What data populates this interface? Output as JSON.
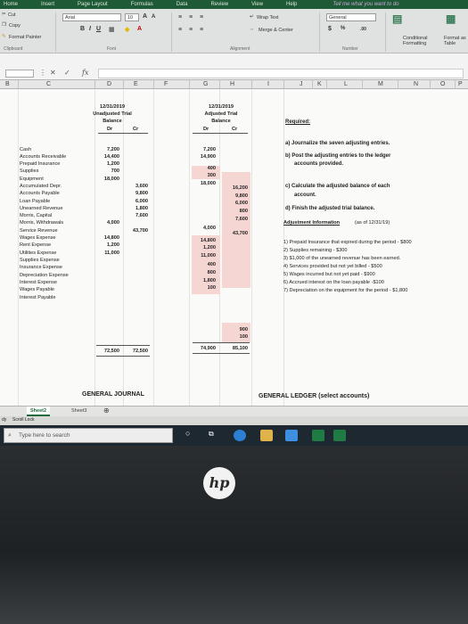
{
  "ribbon_tabs": [
    "Home",
    "Insert",
    "Page Layout",
    "Formulas",
    "Data",
    "Review",
    "View",
    "Help",
    "Tell me what you want to do"
  ],
  "clipboard": {
    "cut": "Cut",
    "copy": "Copy",
    "format_painter": "Format Painter",
    "group": "Clipboard"
  },
  "font": {
    "name": "Arial",
    "size": "10",
    "group": "Font"
  },
  "alignment": {
    "wrap_text": "Wrap Text",
    "merge_center": "Merge & Center",
    "group": "Alignment"
  },
  "number": {
    "format": "General",
    "group": "Number"
  },
  "styles": {
    "conditional": "Conditional Formatting",
    "format_as": "Format as Table"
  },
  "formula_bar": {
    "fx": "fx"
  },
  "columns": [
    "B",
    "C",
    "D",
    "E",
    "F",
    "G",
    "H",
    "I",
    "J",
    "K",
    "L",
    "M",
    "N",
    "O",
    "P"
  ],
  "unadjusted": {
    "date": "12/31/2019",
    "title1": "Unadjusted Trial",
    "title2": "Balance",
    "dr": "Dr",
    "cr": "Cr",
    "dr_values": [
      "7,200",
      "14,400",
      "1,200",
      "700",
      "18,000",
      "4,000",
      "14,800",
      "1,200",
      "11,000"
    ],
    "cr_values": [
      "3,600",
      "9,800",
      "6,000",
      "1,800",
      "7,600",
      "43,700"
    ],
    "total_dr": "72,500",
    "total_cr": "72,500"
  },
  "adjusted": {
    "date": "12/31/2019",
    "title1": "Adjusted Trial",
    "title2": "Balance",
    "dr": "Dr",
    "cr": "Cr",
    "dr_values": [
      "7,200",
      "14,900",
      "400",
      "300",
      "18,000",
      "4,000",
      "14,800",
      "1,200",
      "11,000",
      "400",
      "800",
      "1,800",
      "100"
    ],
    "cr_values": [
      "16,200",
      "9,800",
      "6,000",
      "800",
      "7,600",
      "43,700",
      "900",
      "100"
    ],
    "total_dr": "74,900",
    "total_cr": "85,100"
  },
  "accounts": [
    "Cash",
    "Accounts Receivable",
    "Prepaid Insurance",
    "Supplies",
    "Equipment",
    "Accumulated Depr.",
    "Accounts Payable",
    "Loan Payable",
    "Unearned Revenue",
    "Morris, Capital",
    "Morris, Withdrawals",
    "Service Revenue",
    "Wages Expense",
    "Rent Expense",
    "Utilities Expense",
    "Supplies Expense",
    "Insurance Expense",
    "Depreciation Expense",
    "Interest Expense",
    "Wages Payable",
    "Interest Payable"
  ],
  "required": {
    "heading": "Required:",
    "items": [
      "a) Journalize the seven adjusting entries.",
      "b) Post the adjusting entries to the ledger",
      "accounts provided.",
      "c) Calculate the adjusted balance of each",
      "account.",
      "d) Finish the adjusted trial balance."
    ]
  },
  "adjustment_info": {
    "heading": "Adjustment Information",
    "asof": "(as of 12/31/19)",
    "items": [
      "1) Prepaid Insurance that expired during the period - $800",
      "2) Supplies remaining - $300",
      "3) $1,000 of the unearned revenue has been earned.",
      "4) Services provided but not yet billed - $500",
      "5) Wages incurred but not yet paid - $900",
      "6) Accrued interest on the loan payable -$100",
      "7) Depreciation on the equipment for the period - $1,800"
    ]
  },
  "general_journal": "GENERAL JOURNAL",
  "general_ledger": "GENERAL LEDGER (select accounts)",
  "sheet_tabs": [
    "Sheet2",
    "Sheet3"
  ],
  "status_text": "Scroll Lock",
  "status_prefix": "dy",
  "taskbar": {
    "search_placeholder": "Type here to search"
  },
  "brand": "hp",
  "colors": {
    "ribbon_green": "#1f5a36",
    "highlight_pink": "#f6d6d3",
    "taskbar": "#1d2830"
  }
}
